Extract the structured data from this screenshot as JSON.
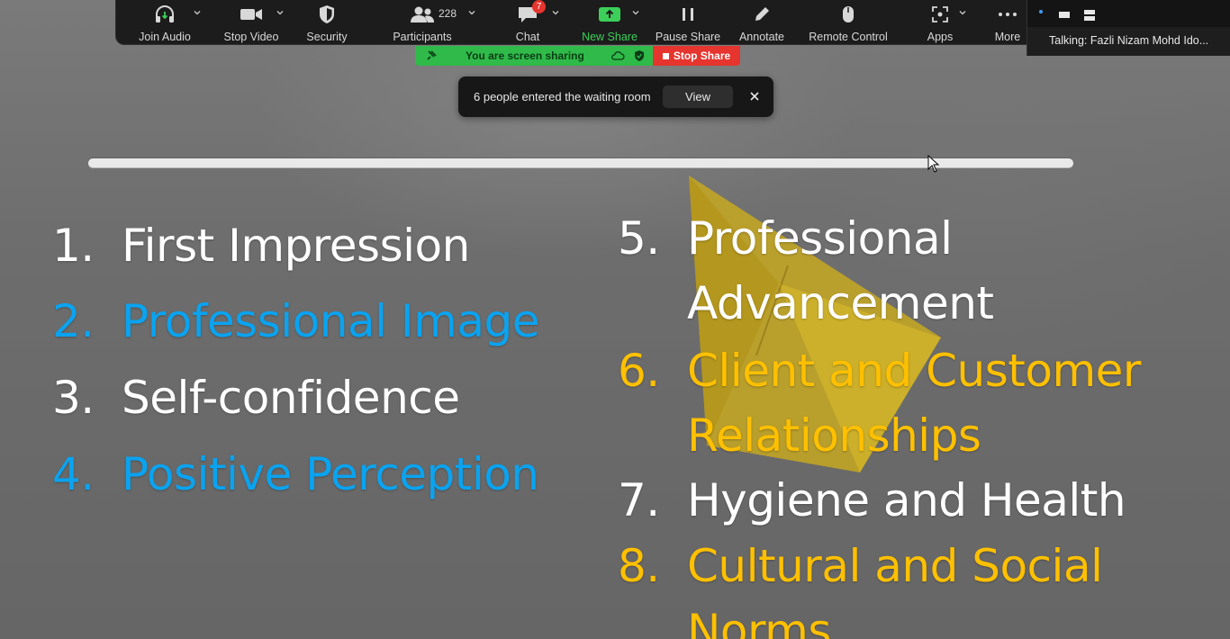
{
  "toolbar": {
    "join_audio": "Join Audio",
    "stop_video": "Stop Video",
    "security": "Security",
    "participants": "Participants",
    "participant_count": "228",
    "chat": "Chat",
    "chat_badge": "7",
    "new_share": "New Share",
    "pause_share": "Pause Share",
    "annotate": "Annotate",
    "remote_control": "Remote Control",
    "apps": "Apps",
    "more": "More"
  },
  "share_bar": {
    "status": "You are screen sharing",
    "stop_label": "Stop Share",
    "status_color": "#2fba4a",
    "stop_color": "#e5352e"
  },
  "notification": {
    "message": "6 people entered the waiting room",
    "view_label": "View",
    "close_label": "×"
  },
  "speaker": {
    "talking": "Talking: Fazli Nizam Mohd Ido..."
  },
  "slide": {
    "items_left": [
      {
        "num": "1.",
        "text": "First Impression",
        "color": "#ffffff"
      },
      {
        "num": "2.",
        "text": "Professional Image",
        "color": "#0aa3f0"
      },
      {
        "num": "3.",
        "text": "Self-confidence",
        "color": "#ffffff"
      },
      {
        "num": "4.",
        "text": "Positive Perception",
        "color": "#0aa3f0"
      }
    ],
    "items_right": [
      {
        "num": "5.",
        "line1": "Professional",
        "line2": "Advancement",
        "color": "#ffffff"
      },
      {
        "num": "6.",
        "line1": "Client and Customer",
        "line2": "Relationships",
        "color": "#ffc000"
      },
      {
        "num": "7.",
        "line1": "Hygiene and Health",
        "color": "#ffffff"
      },
      {
        "num": "8.",
        "line1": "Cultural and Social",
        "line2": "Norms",
        "color": "#ffc000"
      }
    ]
  },
  "colors": {
    "toolbar_bg": "#1c1c1c",
    "accent_green": "#3ccf5a",
    "accent_blue": "#0aa3f0",
    "accent_gold": "#ffc000"
  }
}
